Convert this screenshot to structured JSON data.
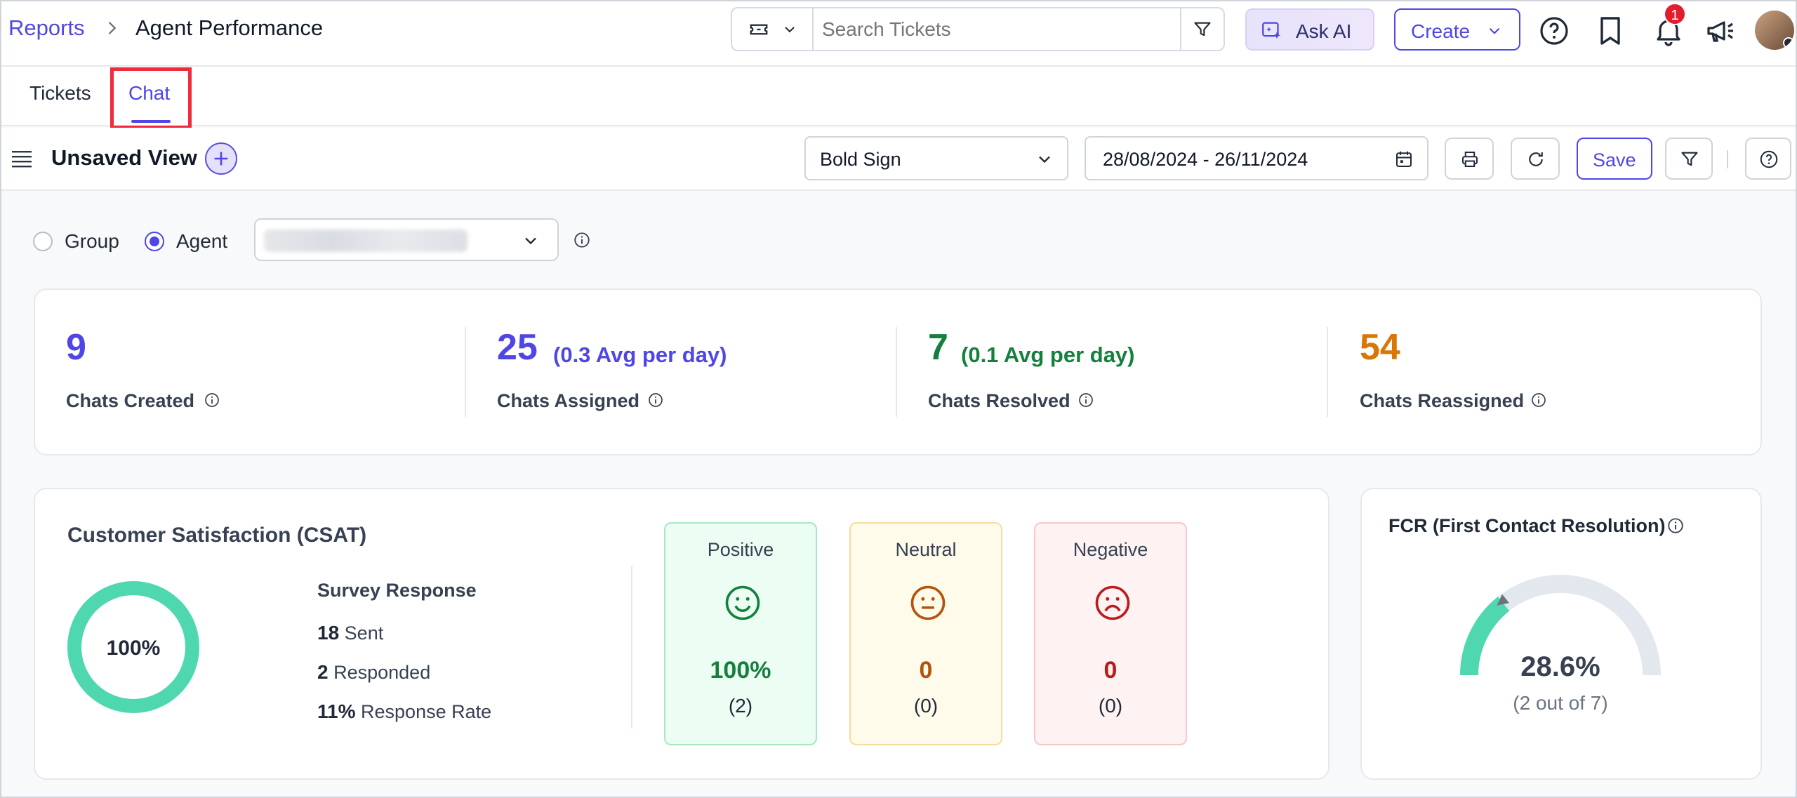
{
  "header": {
    "breadcrumb_root": "Reports",
    "page_title": "Agent Performance",
    "search_placeholder": "Search Tickets",
    "ask_ai_label": "Ask AI",
    "create_label": "Create",
    "notification_count": "1"
  },
  "tabs": [
    {
      "label": "Tickets",
      "active": false
    },
    {
      "label": "Chat",
      "active": true
    }
  ],
  "toolbar": {
    "view_title": "Unsaved View",
    "brand_select": "Bold Sign",
    "date_range": "28/08/2024 - 26/11/2024",
    "save_label": "Save"
  },
  "filters": {
    "group_label": "Group",
    "agent_label": "Agent",
    "selected": "Agent"
  },
  "stats": [
    {
      "value": "9",
      "avg": "",
      "label": "Chats Created",
      "color": "#4f46e5"
    },
    {
      "value": "25",
      "avg": "(0.3 Avg per day)",
      "label": "Chats Assigned",
      "color": "#4f46e5"
    },
    {
      "value": "7",
      "avg": "(0.1 Avg per day)",
      "label": "Chats Resolved",
      "color": "#15803d"
    },
    {
      "value": "54",
      "avg": "",
      "label": "Chats Reassigned",
      "color": "#d97706"
    }
  ],
  "csat": {
    "title": "Customer Satisfaction (CSAT)",
    "score": "100%",
    "score_fraction": 1.0,
    "survey_title": "Survey Response",
    "sent_num": "18",
    "sent_label": "Sent",
    "responded_num": "2",
    "responded_label": "Responded",
    "rate_num": "11%",
    "rate_label": "Response Rate",
    "sentiments": [
      {
        "label": "Positive",
        "pct": "100%",
        "count": "(2)",
        "color": "#15803d",
        "bg": "#ecfdf3",
        "border": "#a7e8c3",
        "icon": "smile-icon"
      },
      {
        "label": "Neutral",
        "pct": "0",
        "count": "(0)",
        "color": "#b45309",
        "bg": "#fffbeb",
        "border": "#f6dd9c",
        "icon": "neutral-face-icon"
      },
      {
        "label": "Negative",
        "pct": "0",
        "count": "(0)",
        "color": "#b91c1c",
        "bg": "#fef2f2",
        "border": "#f6c8c8",
        "icon": "frown-icon"
      }
    ]
  },
  "fcr": {
    "title": "FCR (First Contact Resolution)",
    "value": "28.6%",
    "value_fraction": 0.286,
    "detail": "(2 out of 7)",
    "fill_color": "#4fd8b0",
    "track_color": "#e3e8ef"
  }
}
